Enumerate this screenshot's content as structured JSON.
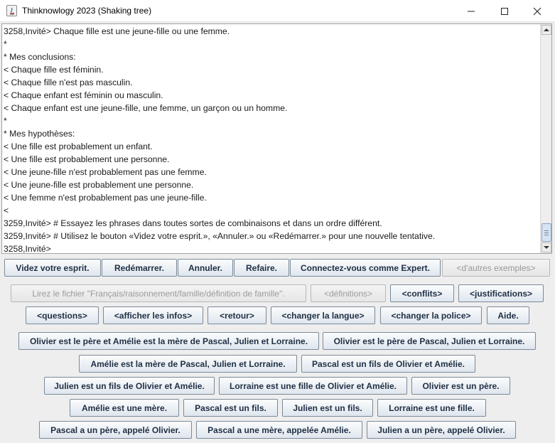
{
  "window": {
    "title": "Thinknowlogy 2023 (Shaking tree)"
  },
  "console": {
    "lines": [
      "3258,Invité> Chaque fille est une jeune-fille ou une femme.",
      "*",
      "* Mes conclusions:",
      "< Chaque fille est féminin.",
      "< Chaque fille n'est pas masculin.",
      "< Chaque enfant est féminin ou masculin.",
      "< Chaque enfant est une jeune-fille, une femme, un garçon ou un homme.",
      "*",
      "* Mes hypothèses:",
      "< Une fille est probablement un enfant.",
      "< Une fille est probablement une personne.",
      "< Une jeune-fille n'est probablement pas une femme.",
      "< Une jeune-fille est probablement une personne.",
      "< Une femme n'est probablement pas une jeune-fille.",
      "<",
      "3259,Invité> # Essayez les phrases dans toutes sortes de combinaisons et dans un ordre différent.",
      "3259,Invité> # Utilisez le bouton «Videz votre esprit.», «Annuler.» ou «Redémarrer.» pour une nouvelle tentative.",
      "3258,Invité>"
    ]
  },
  "toolbar": {
    "clear_mind": "Videz votre esprit.",
    "restart": "Redémarrer.",
    "undo": "Annuler.",
    "redo": "Refaire.",
    "login_expert": "Connectez-vous comme Expert.",
    "other_examples": "<d'autres exemples>"
  },
  "row2": {
    "read_file": "Lirez le fichier \"Français/raisonnement/famille/définition de famille\".",
    "definitions": "<définitions>",
    "conflicts": "<conflits>",
    "justifications": "<justifications>"
  },
  "row3": {
    "questions": "<questions>",
    "show_info": "<afficher les infos>",
    "back": "<retour>",
    "change_language": "<changer la langue>",
    "change_font": "<changer la police>",
    "help": "Aide."
  },
  "sentences": [
    "Olivier est le père et Amélie est la mère de Pascal, Julien et Lorraine.",
    "Olivier est le père de Pascal, Julien et Lorraine.",
    "Amélie est la mère de Pascal, Julien et Lorraine.",
    "Pascal est un fils de Olivier et Amélie.",
    "Julien est un fils de Olivier et Amélie.",
    "Lorraine est une fille de Olivier et Amélie.",
    "Olivier est un père.",
    "Amélie est une mère.",
    "Pascal est un fils.",
    "Julien est un fils.",
    "Lorraine est une fille.",
    "Pascal a un père, appelé Olivier.",
    "Pascal a une mère, appelée Amélie.",
    "Julien a un père, appelé Olivier."
  ]
}
